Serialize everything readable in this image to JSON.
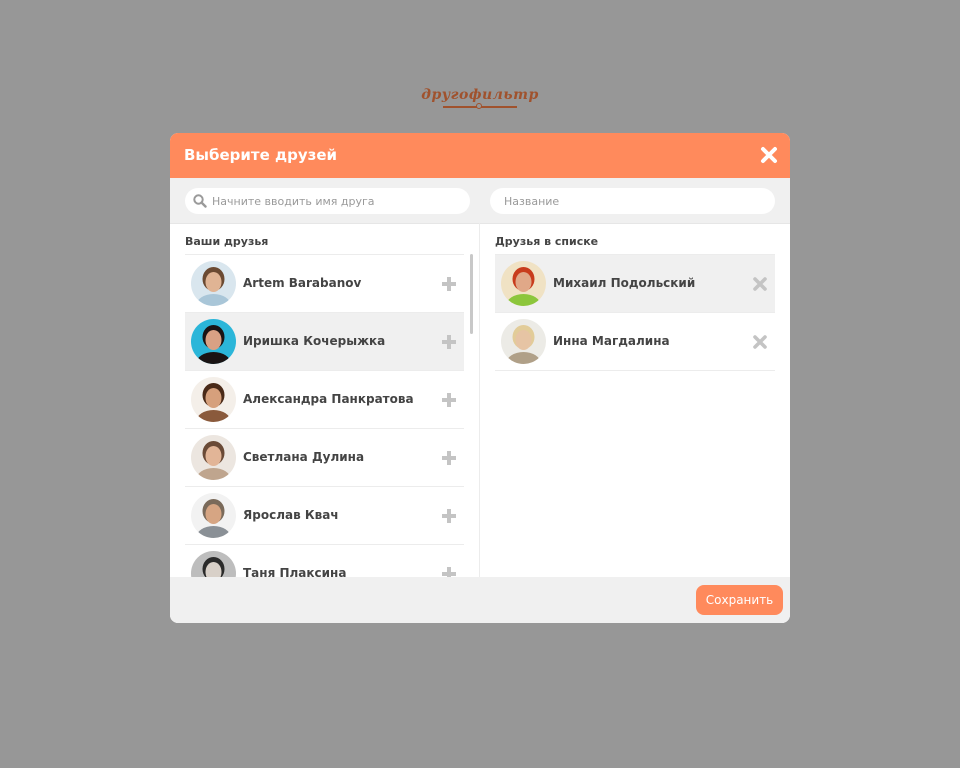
{
  "logo": {
    "text": "другофильтр"
  },
  "modal": {
    "title": "Выберите друзей",
    "friend_search_placeholder": "Начните вводить имя друга",
    "list_name_placeholder": "Название",
    "your_friends_title": "Ваши друзья",
    "list_friends_title": "Друзья в списке",
    "save_label": "Сохранить"
  },
  "colors": {
    "accent": "#ff8a5c",
    "overlay": "#979797",
    "logo": "#a0522d"
  },
  "your_friends": [
    {
      "name": "Artem Barabanov",
      "highlighted": false
    },
    {
      "name": "Иришка Кочерыжка",
      "highlighted": true
    },
    {
      "name": "Александра Панкратова",
      "highlighted": false
    },
    {
      "name": "Светлана Дулина",
      "highlighted": false
    },
    {
      "name": "Ярослав Квач",
      "highlighted": false
    },
    {
      "name": "Таня Плаксина",
      "highlighted": false
    }
  ],
  "list_friends": [
    {
      "name": "Михаил Подольский",
      "highlighted": true
    },
    {
      "name": "Инна Магдалина",
      "highlighted": false
    }
  ]
}
